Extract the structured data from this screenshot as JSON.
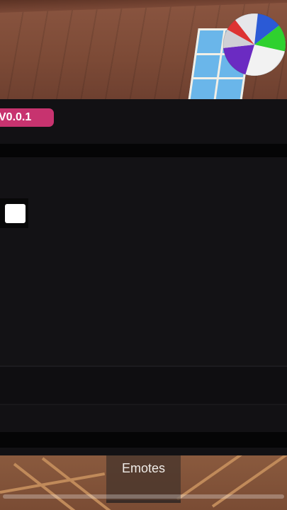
{
  "version_badge": "V0.0.1",
  "bottom_tab": {
    "label": "Emotes"
  },
  "colors": {
    "badge": "#c7336f",
    "panel": "#121114",
    "toggle": "#ffffff"
  },
  "icons": {
    "ball": "beach-ball-icon"
  }
}
